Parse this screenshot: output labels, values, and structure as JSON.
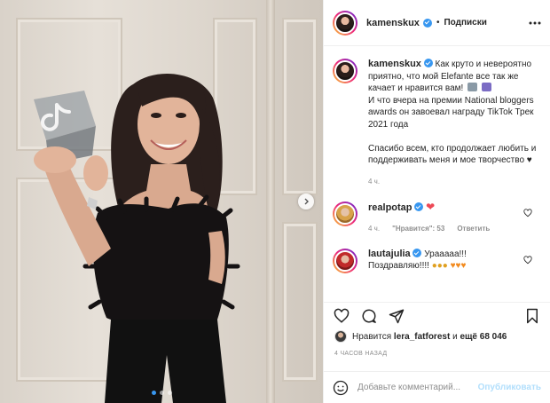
{
  "header": {
    "username": "kamenskux",
    "separator": "•",
    "follow_label": "Подписки"
  },
  "caption": {
    "username": "kamenskux",
    "text_line1": "Как круто и невероятно приятно, что мой Elefante все так же качает и нравится вам!",
    "text_line2": "И что вчера на премии National bloggers awards он завоевал награду TikTok Трек 2021 года",
    "text_line3": "Спасибо всем, кто продолжает любить и поддерживать меня и мое творчество ♥",
    "time": "4 ч."
  },
  "comments": [
    {
      "username": "realpotap",
      "text": "❤",
      "time": "4 ч.",
      "likes_label": "\"Нравится\": 53",
      "reply_label": "Ответить"
    },
    {
      "username": "lautajulia",
      "text": "Урааааа!!! Поздравляю!!!!"
    }
  ],
  "likes": {
    "prefix": "Нравится",
    "user": "lera_fatforest",
    "and": "и",
    "rest": "ещё 68 046"
  },
  "posted_time": "4 ЧАСОВ НАЗАД",
  "add_comment": {
    "placeholder": "Добавьте комментарий...",
    "publish_label": "Опубликовать"
  },
  "carousel": {
    "slide_count": 3,
    "active_index": 1
  },
  "colors": {
    "verified": "#3897f0",
    "heart": "#ed4956",
    "publish_disabled": "#b2dffc"
  },
  "icons": {
    "more": "more-horizontal-icon",
    "like": "heart-icon",
    "comment": "comment-bubble-icon",
    "share": "paper-plane-icon",
    "save": "bookmark-icon",
    "emoji": "smiley-icon",
    "next": "chevron-right-icon"
  }
}
